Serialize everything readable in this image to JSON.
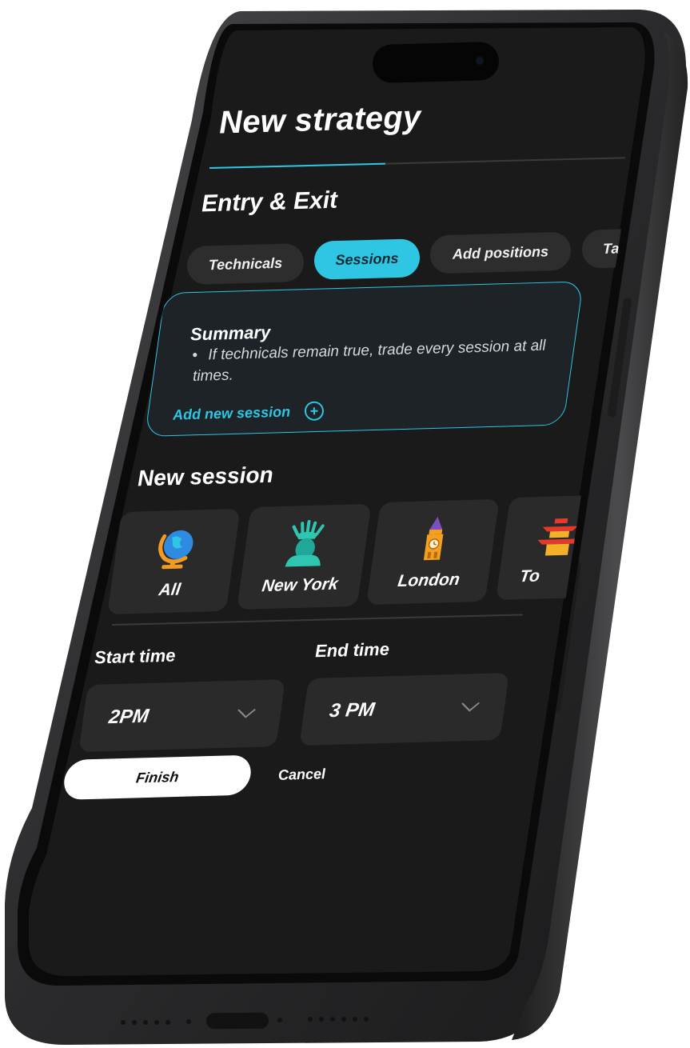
{
  "header": {
    "title": "New strategy"
  },
  "entry_exit": {
    "title": "Entry & Exit",
    "tabs": [
      {
        "label": "Technicals",
        "active": false
      },
      {
        "label": "Sessions",
        "active": true
      },
      {
        "label": "Add positions",
        "active": false
      },
      {
        "label": "Ta",
        "active": false
      }
    ]
  },
  "summary": {
    "title": "Summary",
    "bullet": "If technicals remain true, trade every session at all times.",
    "add_label": "Add new session"
  },
  "new_session": {
    "title": "New session",
    "cities": [
      {
        "label": "All",
        "icon": "globe-icon"
      },
      {
        "label": "New York",
        "icon": "statue-of-liberty-icon"
      },
      {
        "label": "London",
        "icon": "big-ben-icon"
      },
      {
        "label": "To",
        "icon": "pagoda-icon"
      }
    ]
  },
  "time": {
    "start_label": "Start time",
    "start_value": "2PM",
    "end_label": "End time",
    "end_value": "3 PM"
  },
  "actions": {
    "finish": "Finish",
    "cancel": "Cancel"
  },
  "colors": {
    "accent": "#2ec6e3",
    "screen": "#1a1a1a",
    "card": "#2a2a2a"
  }
}
